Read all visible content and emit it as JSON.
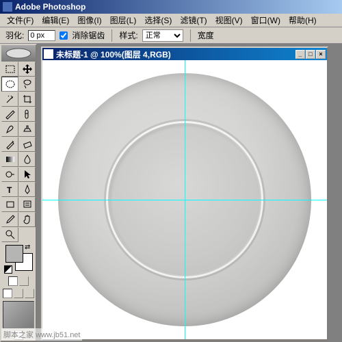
{
  "app": {
    "title": "Adobe Photoshop"
  },
  "menu": {
    "file": "文件(F)",
    "edit": "编辑(E)",
    "image": "图像(I)",
    "layer": "图层(L)",
    "select": "选择(S)",
    "filter": "滤镜(T)",
    "view": "视图(V)",
    "window": "窗口(W)",
    "help": "帮助(H)"
  },
  "optbar": {
    "feather_label": "羽化:",
    "feather_value": "0 px",
    "antialias_label": "消除锯齿",
    "style_label": "样式:",
    "style_value": "正常",
    "width_label": "宽度"
  },
  "doc": {
    "title": "未标题-1 @ 100%(图层 4,RGB)",
    "min": "_",
    "max": "□",
    "close": "×"
  },
  "colors": {
    "foreground": "#b5b5b3",
    "guide": "#00ffff"
  },
  "watermark": "脚本之家 www.jb51.net"
}
